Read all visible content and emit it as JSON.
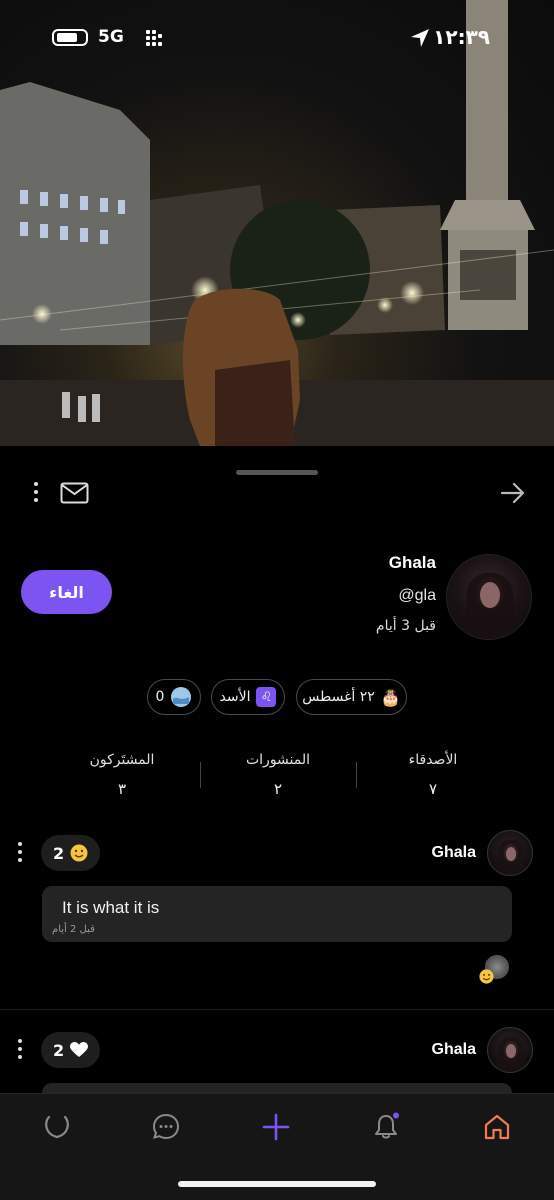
{
  "status_bar": {
    "network": "5G",
    "time": "١٢:٣٩"
  },
  "profile": {
    "name": "Ghala",
    "handle": "@gla",
    "joined": "قبل 3 أيام",
    "cancel_label": "الغاء"
  },
  "chips": {
    "birthday": "٢٢ أغسطس",
    "zodiac": "الأسد",
    "water": "0"
  },
  "stats": [
    {
      "label": "الأصدقاء",
      "value": "٧"
    },
    {
      "label": "المنشورات",
      "value": "٢"
    },
    {
      "label": "المشتَركون",
      "value": "٣"
    }
  ],
  "posts": [
    {
      "author": "Ghala",
      "reaction_count": "2",
      "reaction_icon": "smile-emoji-icon",
      "text": "It is what it is",
      "time": "قبل 2 أيام"
    },
    {
      "author": "Ghala",
      "reaction_count": "2",
      "reaction_icon": "heart-icon"
    }
  ],
  "nav": [
    "magnet-icon",
    "chat-icon",
    "plus-icon",
    "bell-icon",
    "home-icon"
  ],
  "colors": {
    "accent": "#7b54f2",
    "home_active": "#f07a5a",
    "background": "#000000"
  }
}
